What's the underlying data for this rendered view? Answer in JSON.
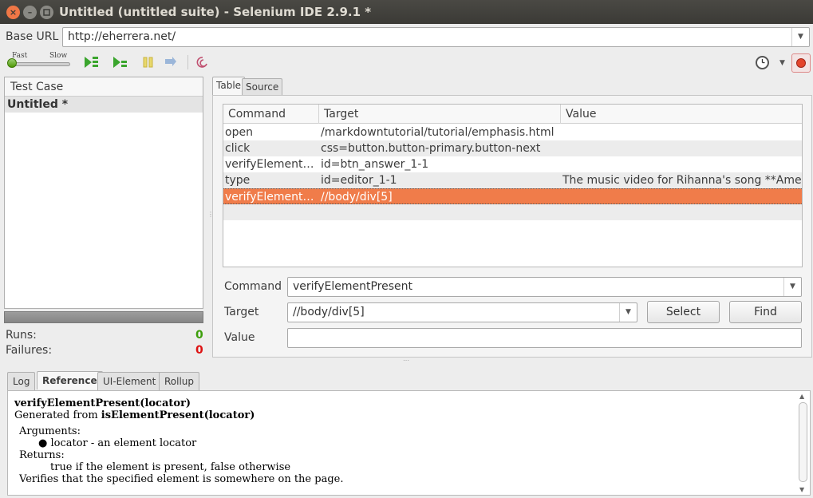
{
  "window": {
    "title": "Untitled (untitled suite) - Selenium IDE 2.9.1 *",
    "close_glyph": "×",
    "min_glyph": "–"
  },
  "baseurl": {
    "label": "Base URL",
    "value": "http://eherrera.net/"
  },
  "toolbar": {
    "speed_fast": "Fast",
    "speed_slow": "Slow"
  },
  "testcase": {
    "header": "Test Case",
    "items": [
      "Untitled *"
    ],
    "runs_label": "Runs:",
    "runs_value": "0",
    "failures_label": "Failures:",
    "failures_value": "0"
  },
  "editor_tabs": [
    "Table",
    "Source"
  ],
  "table": {
    "columns": [
      "Command",
      "Target",
      "Value"
    ],
    "rows": [
      {
        "command": "open",
        "target": "/markdowntutorial/tutorial/emphasis.html",
        "value": ""
      },
      {
        "command": "click",
        "target": "css=button.button-primary.button-next",
        "value": ""
      },
      {
        "command": "verifyElement…",
        "target": "id=btn_answer_1-1",
        "value": ""
      },
      {
        "command": "type",
        "target": "id=editor_1-1",
        "value": "The music video for Rihanna's song **Ame…"
      },
      {
        "command": "verifyElement…",
        "target": "//body/div[5]",
        "value": ""
      }
    ]
  },
  "form": {
    "command_label": "Command",
    "command_value": "verifyElementPresent",
    "target_label": "Target",
    "target_value": "//body/div[5]",
    "value_label": "Value",
    "value_value": "",
    "select_button": "Select",
    "find_button": "Find"
  },
  "bottom_tabs": [
    "Log",
    "Reference",
    "UI-Element",
    "Rollup"
  ],
  "reference": {
    "signature": "verifyElementPresent(locator)",
    "generated_prefix": "Generated from ",
    "generated_fn": "isElementPresent(locator)",
    "arguments_label": "Arguments:",
    "argument_1": "locator - an element locator",
    "returns_label": "Returns:",
    "returns_text": "true if the element is present, false otherwise",
    "description": "Verifies that the specified element is somewhere on the page."
  },
  "colors": {
    "selected_row": "#f07c4a",
    "runs_green": "#3c9e0a",
    "failures_red": "#d11111",
    "record_red": "#e3452c"
  }
}
